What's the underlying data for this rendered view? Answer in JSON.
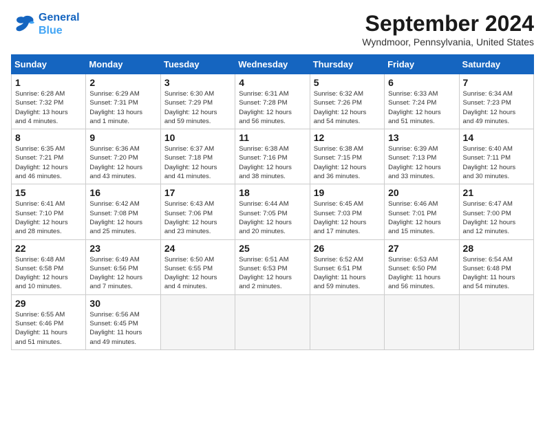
{
  "header": {
    "logo_line1": "General",
    "logo_line2": "Blue",
    "month_year": "September 2024",
    "location": "Wyndmoor, Pennsylvania, United States"
  },
  "weekdays": [
    "Sunday",
    "Monday",
    "Tuesday",
    "Wednesday",
    "Thursday",
    "Friday",
    "Saturday"
  ],
  "weeks": [
    [
      {
        "day": "1",
        "info": "Sunrise: 6:28 AM\nSunset: 7:32 PM\nDaylight: 13 hours\nand 4 minutes."
      },
      {
        "day": "2",
        "info": "Sunrise: 6:29 AM\nSunset: 7:31 PM\nDaylight: 13 hours\nand 1 minute."
      },
      {
        "day": "3",
        "info": "Sunrise: 6:30 AM\nSunset: 7:29 PM\nDaylight: 12 hours\nand 59 minutes."
      },
      {
        "day": "4",
        "info": "Sunrise: 6:31 AM\nSunset: 7:28 PM\nDaylight: 12 hours\nand 56 minutes."
      },
      {
        "day": "5",
        "info": "Sunrise: 6:32 AM\nSunset: 7:26 PM\nDaylight: 12 hours\nand 54 minutes."
      },
      {
        "day": "6",
        "info": "Sunrise: 6:33 AM\nSunset: 7:24 PM\nDaylight: 12 hours\nand 51 minutes."
      },
      {
        "day": "7",
        "info": "Sunrise: 6:34 AM\nSunset: 7:23 PM\nDaylight: 12 hours\nand 49 minutes."
      }
    ],
    [
      {
        "day": "8",
        "info": "Sunrise: 6:35 AM\nSunset: 7:21 PM\nDaylight: 12 hours\nand 46 minutes."
      },
      {
        "day": "9",
        "info": "Sunrise: 6:36 AM\nSunset: 7:20 PM\nDaylight: 12 hours\nand 43 minutes."
      },
      {
        "day": "10",
        "info": "Sunrise: 6:37 AM\nSunset: 7:18 PM\nDaylight: 12 hours\nand 41 minutes."
      },
      {
        "day": "11",
        "info": "Sunrise: 6:38 AM\nSunset: 7:16 PM\nDaylight: 12 hours\nand 38 minutes."
      },
      {
        "day": "12",
        "info": "Sunrise: 6:38 AM\nSunset: 7:15 PM\nDaylight: 12 hours\nand 36 minutes."
      },
      {
        "day": "13",
        "info": "Sunrise: 6:39 AM\nSunset: 7:13 PM\nDaylight: 12 hours\nand 33 minutes."
      },
      {
        "day": "14",
        "info": "Sunrise: 6:40 AM\nSunset: 7:11 PM\nDaylight: 12 hours\nand 30 minutes."
      }
    ],
    [
      {
        "day": "15",
        "info": "Sunrise: 6:41 AM\nSunset: 7:10 PM\nDaylight: 12 hours\nand 28 minutes."
      },
      {
        "day": "16",
        "info": "Sunrise: 6:42 AM\nSunset: 7:08 PM\nDaylight: 12 hours\nand 25 minutes."
      },
      {
        "day": "17",
        "info": "Sunrise: 6:43 AM\nSunset: 7:06 PM\nDaylight: 12 hours\nand 23 minutes."
      },
      {
        "day": "18",
        "info": "Sunrise: 6:44 AM\nSunset: 7:05 PM\nDaylight: 12 hours\nand 20 minutes."
      },
      {
        "day": "19",
        "info": "Sunrise: 6:45 AM\nSunset: 7:03 PM\nDaylight: 12 hours\nand 17 minutes."
      },
      {
        "day": "20",
        "info": "Sunrise: 6:46 AM\nSunset: 7:01 PM\nDaylight: 12 hours\nand 15 minutes."
      },
      {
        "day": "21",
        "info": "Sunrise: 6:47 AM\nSunset: 7:00 PM\nDaylight: 12 hours\nand 12 minutes."
      }
    ],
    [
      {
        "day": "22",
        "info": "Sunrise: 6:48 AM\nSunset: 6:58 PM\nDaylight: 12 hours\nand 10 minutes."
      },
      {
        "day": "23",
        "info": "Sunrise: 6:49 AM\nSunset: 6:56 PM\nDaylight: 12 hours\nand 7 minutes."
      },
      {
        "day": "24",
        "info": "Sunrise: 6:50 AM\nSunset: 6:55 PM\nDaylight: 12 hours\nand 4 minutes."
      },
      {
        "day": "25",
        "info": "Sunrise: 6:51 AM\nSunset: 6:53 PM\nDaylight: 12 hours\nand 2 minutes."
      },
      {
        "day": "26",
        "info": "Sunrise: 6:52 AM\nSunset: 6:51 PM\nDaylight: 11 hours\nand 59 minutes."
      },
      {
        "day": "27",
        "info": "Sunrise: 6:53 AM\nSunset: 6:50 PM\nDaylight: 11 hours\nand 56 minutes."
      },
      {
        "day": "28",
        "info": "Sunrise: 6:54 AM\nSunset: 6:48 PM\nDaylight: 11 hours\nand 54 minutes."
      }
    ],
    [
      {
        "day": "29",
        "info": "Sunrise: 6:55 AM\nSunset: 6:46 PM\nDaylight: 11 hours\nand 51 minutes."
      },
      {
        "day": "30",
        "info": "Sunrise: 6:56 AM\nSunset: 6:45 PM\nDaylight: 11 hours\nand 49 minutes."
      },
      null,
      null,
      null,
      null,
      null
    ]
  ]
}
